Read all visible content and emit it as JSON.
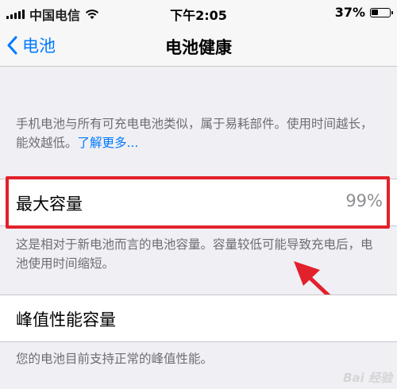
{
  "status_bar": {
    "carrier": "中国电信",
    "time": "下午2:05",
    "battery_percent": "37%",
    "battery_level": 0.37
  },
  "nav": {
    "back_label": "电池",
    "title": "电池健康"
  },
  "intro": {
    "text": "手机电池与所有可充电电池类似，属于易耗部件。使用时间越长，能效越低。",
    "link": "了解更多..."
  },
  "max_capacity": {
    "label": "最大容量",
    "value": "99%",
    "description": "这是相对于新电池而言的电池容量。容量较低可能导致充电后，电池使用时间缩短。"
  },
  "peak_performance": {
    "label": "峰值性能容量",
    "description": "您的电池目前支持正常的峰值性能。"
  },
  "colors": {
    "accent": "#007aff",
    "highlight": "#e2212c",
    "background": "#efeff4"
  }
}
